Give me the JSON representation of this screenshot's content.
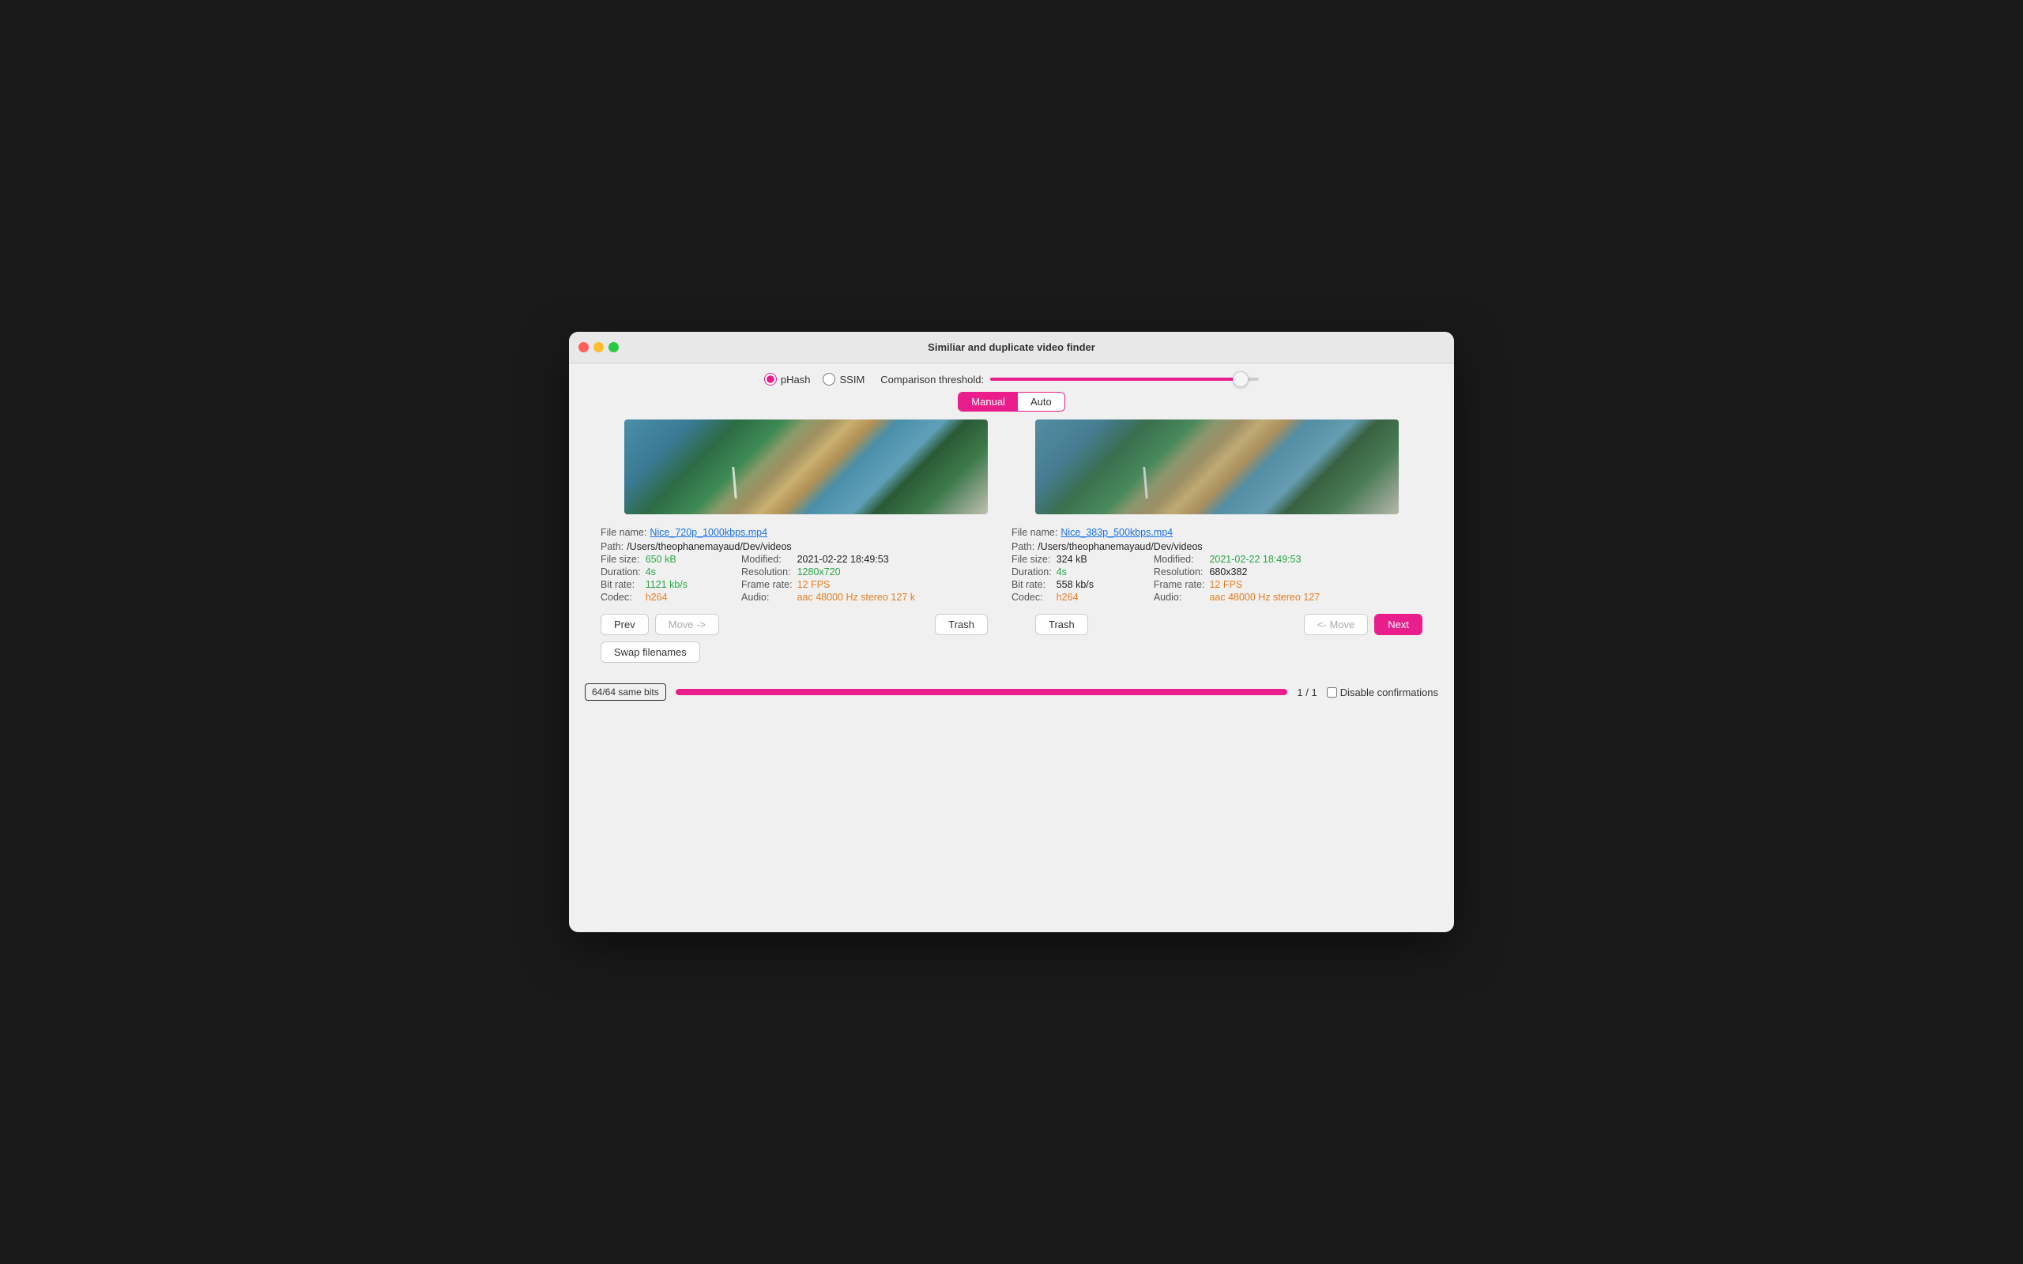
{
  "window": {
    "title": "Similiar and duplicate video finder"
  },
  "toolbar": {
    "phash_label": "pHash",
    "ssim_label": "SSIM",
    "threshold_label": "Comparison threshold:",
    "threshold_value": 96,
    "mode_manual": "Manual",
    "mode_auto": "Auto"
  },
  "left_video": {
    "filename_label": "File name:",
    "filename_value": "Nice_720p_1000kbps.mp4",
    "path_label": "Path:",
    "path_value": "/Users/theophanemayaud/Dev/videos",
    "filesize_label": "File size:",
    "filesize_value": "650 kB",
    "modified_label": "Modified:",
    "modified_value": "2021-02-22 18:49:53",
    "duration_label": "Duration:",
    "duration_value": "4s",
    "resolution_label": "Resolution:",
    "resolution_value": "1280x720",
    "bitrate_label": "Bit rate:",
    "bitrate_value": "1121 kb/s",
    "framerate_label": "Frame rate:",
    "framerate_value": "12 FPS",
    "codec_label": "Codec:",
    "codec_value": "h264",
    "audio_label": "Audio:",
    "audio_value": "aac 48000 Hz stereo 127 k"
  },
  "right_video": {
    "filename_label": "File name:",
    "filename_value": "Nice_383p_500kbps.mp4",
    "path_label": "Path:",
    "path_value": "/Users/theophanemayaud/Dev/videos",
    "filesize_label": "File size:",
    "filesize_value": "324 kB",
    "modified_label": "Modified:",
    "modified_value": "2021-02-22 18:49:53",
    "duration_label": "Duration:",
    "duration_value": "4s",
    "resolution_label": "Resolution:",
    "resolution_value": "680x382",
    "bitrate_label": "Bit rate:",
    "bitrate_value": "558 kb/s",
    "framerate_label": "Frame rate:",
    "framerate_value": "12 FPS",
    "codec_label": "Codec:",
    "codec_value": "h264",
    "audio_label": "Audio:",
    "audio_value": "aac 48000 Hz stereo 127"
  },
  "buttons": {
    "prev": "Prev",
    "move_right": "Move ->",
    "trash_left": "Trash",
    "trash_right": "Trash",
    "move_left": "<- Move",
    "next": "Next",
    "swap_filenames": "Swap filenames"
  },
  "bottom": {
    "same_bits": "64/64 same bits",
    "progress_pct": 100,
    "page_indicator": "1 / 1",
    "disable_confirmations": "Disable confirmations"
  }
}
